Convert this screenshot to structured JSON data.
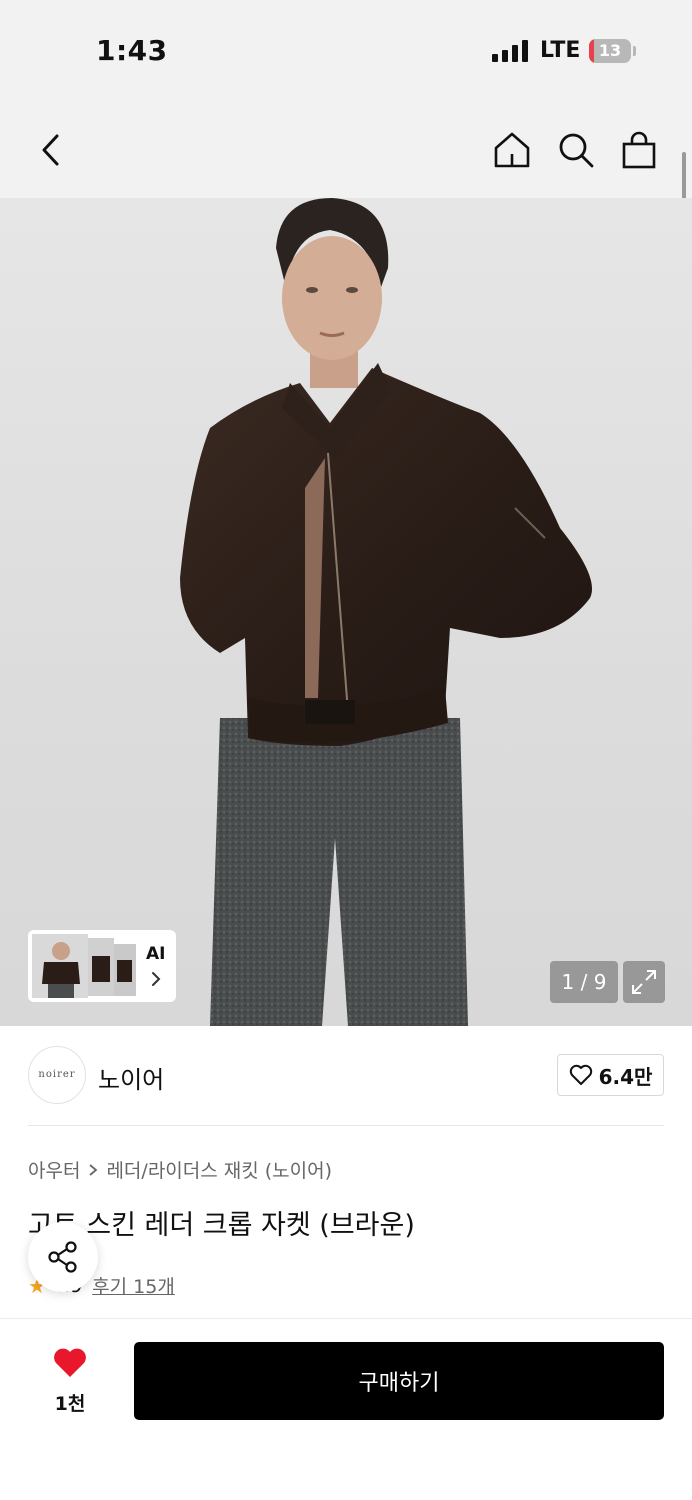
{
  "status": {
    "time": "1:43",
    "network": "LTE",
    "battery": "13",
    "battery_level": 0.13
  },
  "gallery": {
    "counter": "1 / 9",
    "ai_label": "AI"
  },
  "brand": {
    "logo_text": "noirer",
    "name": "노이어",
    "likes": "6.4만"
  },
  "breadcrumb": {
    "category": "아우터",
    "subcategory": "레더/라이더스 재킷 (노이어)"
  },
  "product": {
    "title": "고트 스킨 레더 크롭 자켓 (브라운)",
    "rating": "4.9",
    "review_link": "후기 15개"
  },
  "footer": {
    "wish_count": "1천",
    "buy_label": "구매하기"
  },
  "colors": {
    "accent_heart": "#e8172c",
    "star": "#f5a623",
    "buy_button": "#000000"
  }
}
